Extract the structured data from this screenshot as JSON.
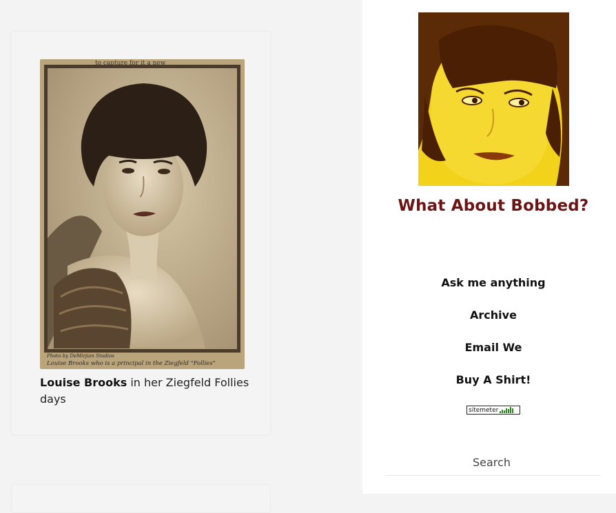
{
  "post": {
    "caption_name": "Louise Brooks",
    "caption_rest": " in her Ziegfeld Follies days",
    "photo_top_text": "to capture for it a new",
    "photo_credit": "Photo by DeMirjian Studios",
    "photo_subtitle": "Louise Brooks who is a principal in the Ziegfeld \"Follies\""
  },
  "sidebar": {
    "title": "What About Bobbed?",
    "nav": [
      {
        "label": "Ask me anything"
      },
      {
        "label": "Archive"
      },
      {
        "label": "Email We"
      },
      {
        "label": "Buy A Shirt!"
      }
    ],
    "sitemeter_label": "sitemeter",
    "search_label": "Search"
  },
  "colors": {
    "title": "#6b1414",
    "background": "#f3f3f3",
    "sidebar_background": "#ffffff",
    "avatar_tint": "#e8c400"
  }
}
